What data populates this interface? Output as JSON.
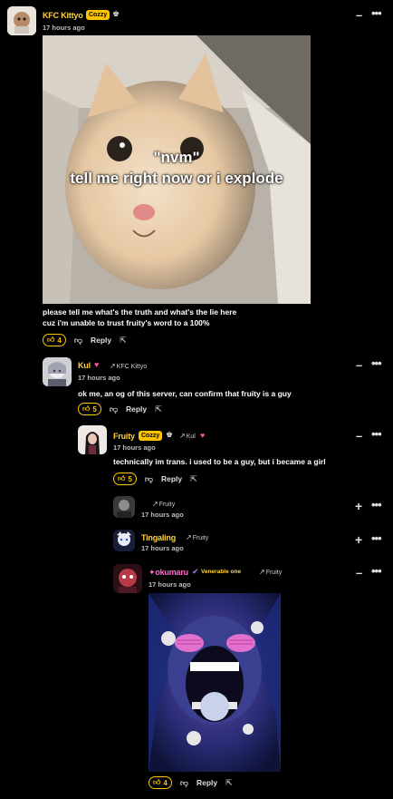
{
  "comments": [
    {
      "user": "KFC Kittyo",
      "badge": "Cozzy",
      "time": "17 hours ago",
      "text_lines": [
        "please tell me what's the truth and what's the lie here",
        "cuz i'm unable to trust fruity's word to a 100%"
      ],
      "image_caption_1": "\"nvm\"",
      "image_caption_2": "tell me right now or i explode",
      "likes": "4",
      "reply_label": "Reply"
    },
    {
      "user": "Kul",
      "reply_to": "KFC Kittyo",
      "time": "17 hours ago",
      "text_lines": [
        "ok me, an og of this server, can confirm that fruity is a guy"
      ],
      "likes": "5",
      "reply_label": "Reply"
    },
    {
      "user": "Fruity",
      "badge": "Cozzy",
      "reply_to": "Kul",
      "time": "17 hours ago",
      "text_lines": [
        "technically im trans. i used to be a guy, but i became a girl"
      ],
      "likes": "5",
      "reply_label": "Reply"
    },
    {
      "user": "",
      "reply_to": "Fruity",
      "time": "17 hours ago"
    },
    {
      "user": "Tingaling",
      "reply_to": "Fruity",
      "time": "17 hours ago"
    },
    {
      "user": "✦okumaru",
      "flair": "Venerable one",
      "reply_to": "Fruity",
      "time": "17 hours ago",
      "likes": "4",
      "reply_label": "Reply"
    }
  ],
  "icons": {
    "like": "thumbs-up-icon",
    "dislike": "thumbs-down-icon",
    "share": "share-icon",
    "collapse": "minus-icon",
    "expand": "plus-icon",
    "more": "more-dots-icon",
    "reply_arrow": "reply-arrow-icon",
    "heart": "heart-icon",
    "verified": "verified-icon"
  },
  "colors": {
    "background": "#000000",
    "accent": "#ffc400",
    "username_gold": "#ffd23f",
    "username_blue": "#5aa6ff",
    "username_pink": "#ff6bd0",
    "heart": "#ff4fa0"
  }
}
